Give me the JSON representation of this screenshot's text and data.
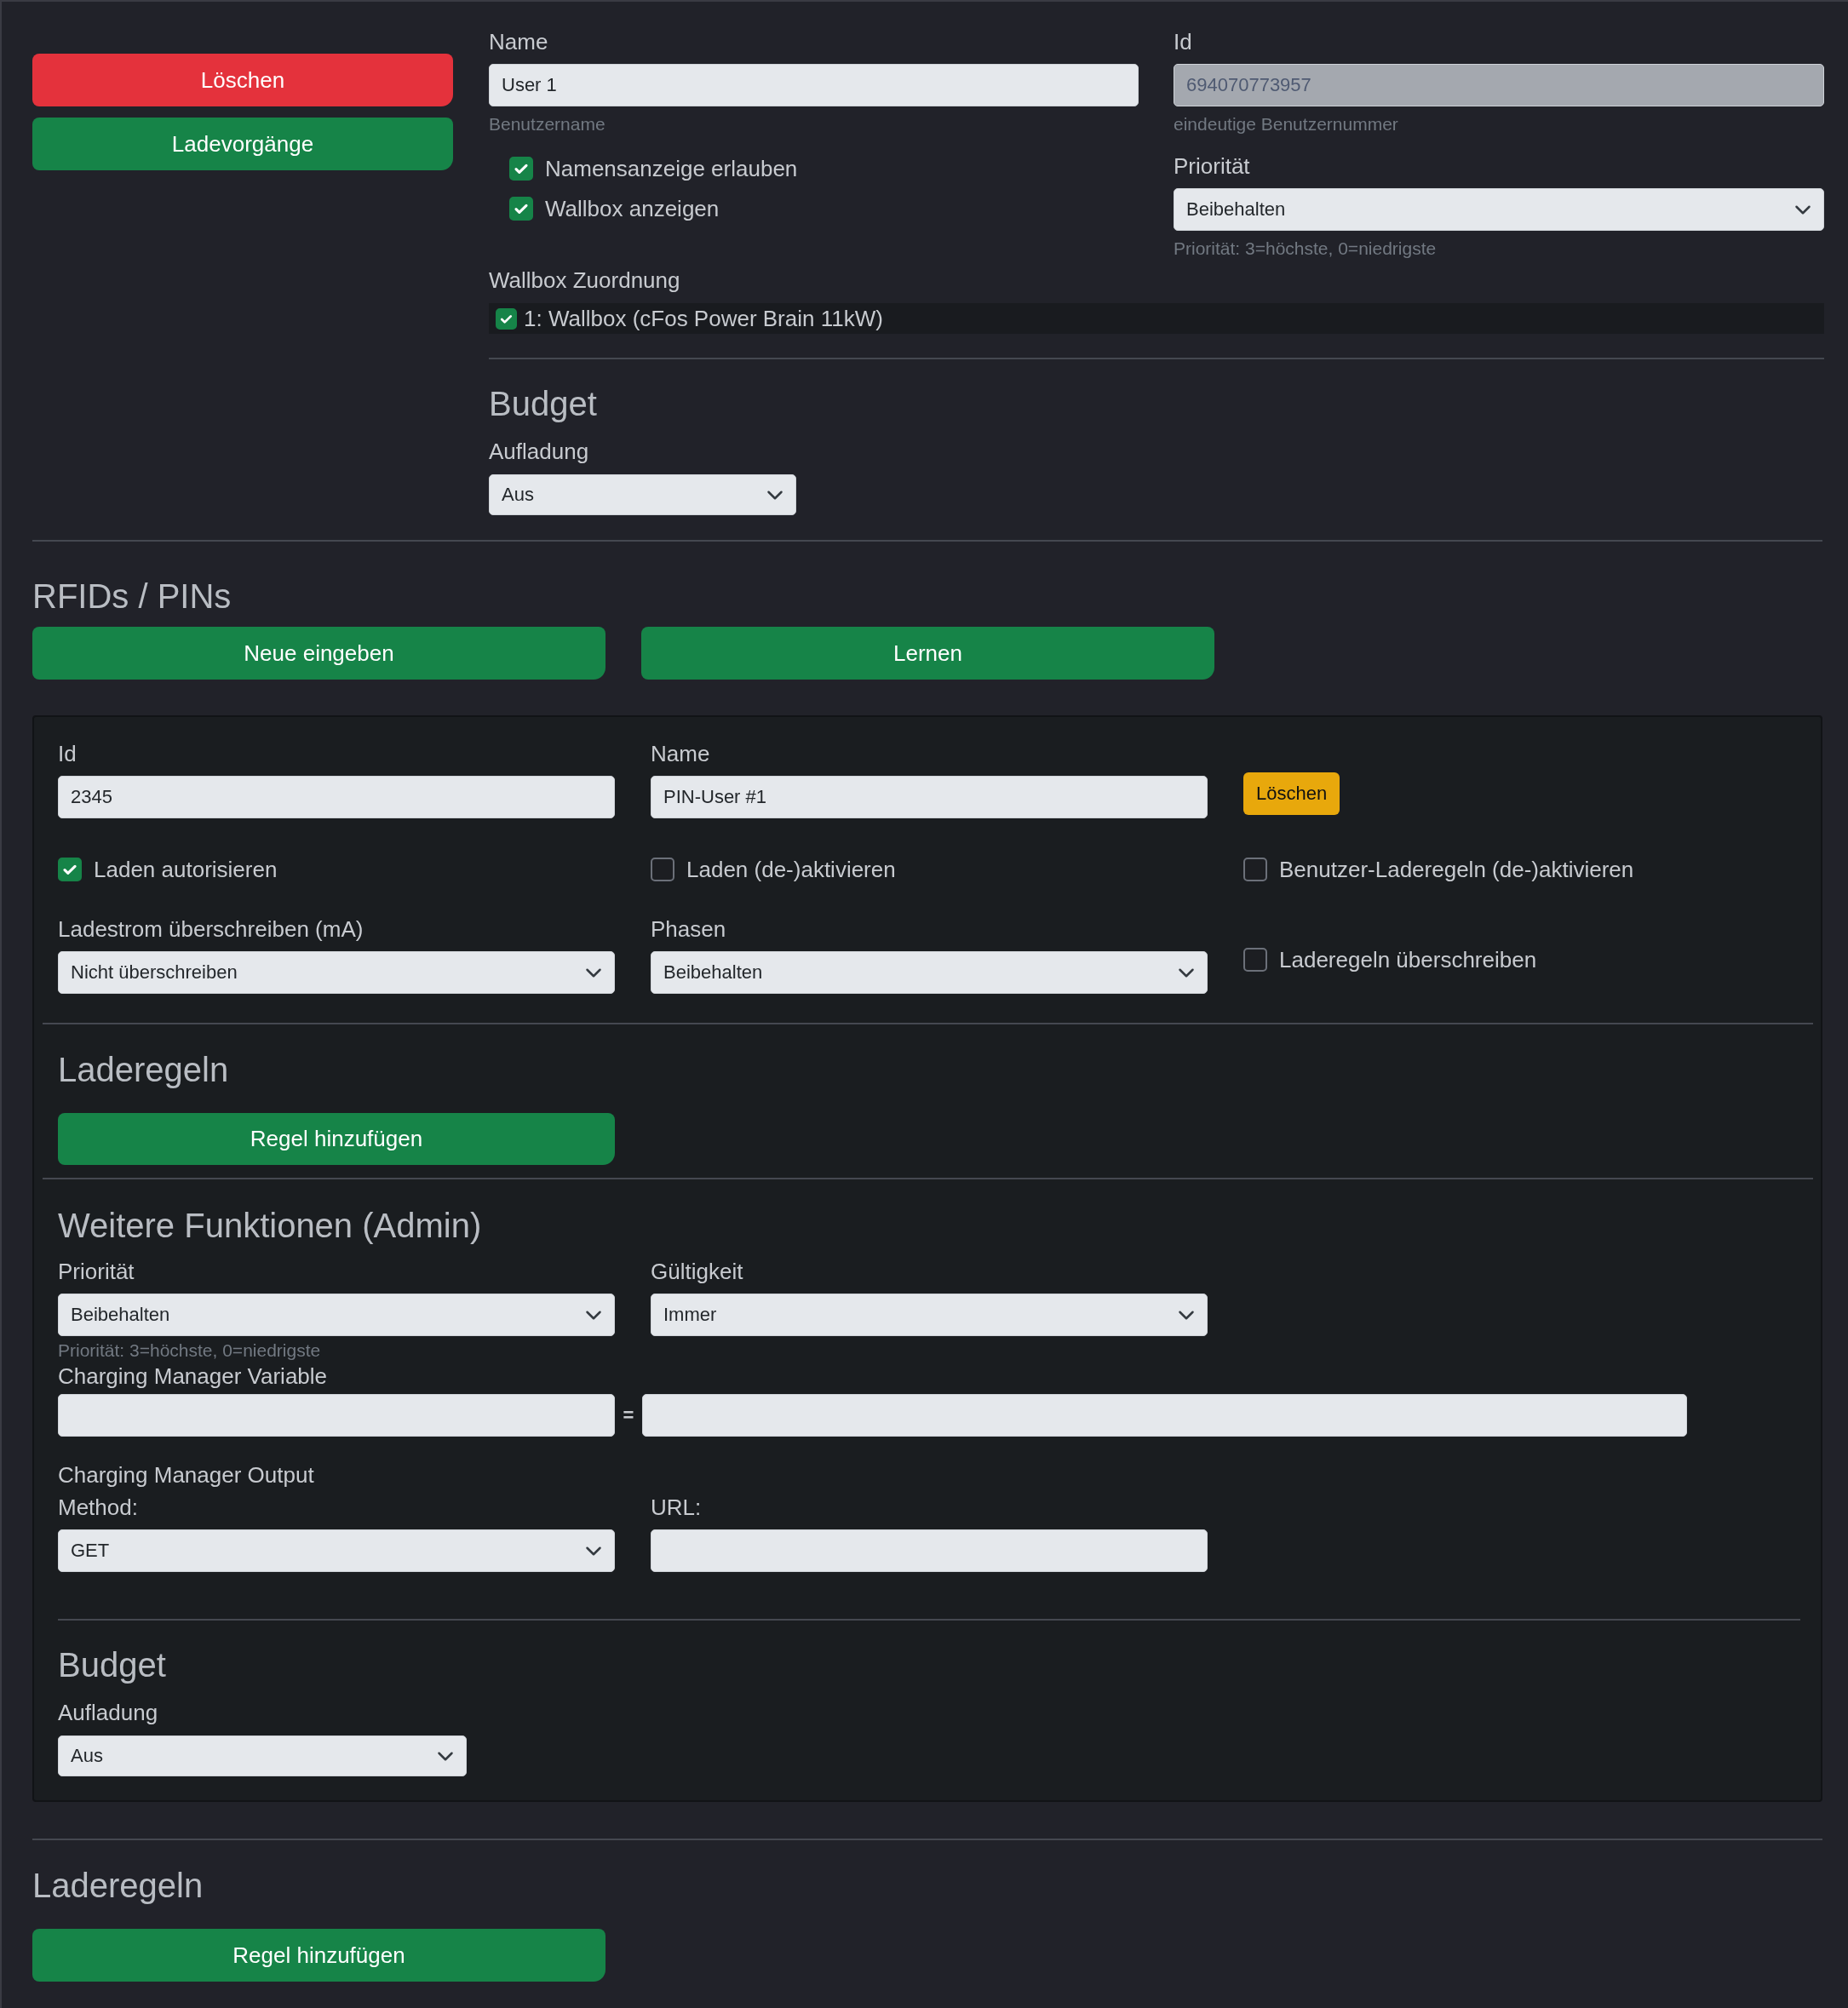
{
  "actions": [
    {
      "label": "Löschen",
      "kind": "danger"
    },
    {
      "label": "Ladevorgänge",
      "kind": "success"
    }
  ],
  "user": {
    "name": {
      "label": "Name",
      "value": "User 1",
      "help": "Benutzername"
    },
    "id": {
      "label": "Id",
      "value": "694070773957",
      "help": "eindeutige Benutzernummer",
      "disabled": true
    },
    "options": [
      {
        "label": "Namensanzeige erlauben",
        "checked": true
      },
      {
        "label": "Wallbox anzeigen",
        "checked": true
      }
    ],
    "priority": {
      "label": "Priorität",
      "value": "Beibehalten",
      "help": "Priorität: 3=höchste, 0=niedrigste"
    },
    "wallbox_assignment": {
      "label": "Wallbox Zuordnung",
      "items": [
        {
          "label": "1: Wallbox (cFos Power Brain 11kW)",
          "checked": true
        }
      ]
    },
    "budget": {
      "title": "Budget",
      "label": "Aufladung",
      "value": "Aus"
    }
  },
  "rfids": {
    "title": "RFIDs / PINs",
    "buttons": [
      {
        "label": "Neue eingeben",
        "kind": "success"
      },
      {
        "label": "Lernen",
        "kind": "success"
      }
    ],
    "entries": [
      {
        "fields": [
          {
            "kind": "input",
            "label": "Id",
            "value": "2345"
          },
          {
            "kind": "input",
            "label": "Name",
            "value": "PIN-User #1"
          },
          {
            "kind": "button",
            "label": "Löschen"
          },
          {
            "kind": "checkbox",
            "label": "Laden autorisieren",
            "checked": true
          },
          {
            "kind": "checkbox",
            "label": "Laden (de-)aktivieren",
            "checked": false
          },
          {
            "kind": "checkbox",
            "label": "Benutzer-Laderegeln (de-)aktivieren",
            "checked": false
          },
          {
            "kind": "select",
            "label": "Ladestrom überschreiben (mA)",
            "value": "Nicht überschreiben"
          },
          {
            "kind": "select",
            "label": "Phasen",
            "value": "Beibehalten"
          },
          {
            "kind": "checkbox",
            "label": "Laderegeln überschreiben",
            "checked": false
          }
        ],
        "rules": {
          "title": "Laderegeln",
          "button": "Regel hinzufügen"
        },
        "admin": {
          "title": "Weitere Funktionen (Admin)",
          "priority": {
            "label": "Priorität",
            "value": "Beibehalten",
            "help": "Priorität: 3=höchste, 0=niedrigste"
          },
          "validity": {
            "label": "Gültigkeit",
            "value": "Immer"
          },
          "variable": {
            "label": "Charging Manager Variable",
            "operator": "="
          },
          "output": {
            "label": "Charging Manager Output",
            "method": {
              "label": "Method:",
              "value": "GET"
            },
            "url": {
              "label": "URL:"
            }
          }
        },
        "budget": {
          "title": "Budget",
          "label": "Aufladung",
          "value": "Aus"
        }
      }
    ]
  },
  "charging_rules": {
    "title": "Laderegeln",
    "button": "Regel hinzufügen"
  }
}
